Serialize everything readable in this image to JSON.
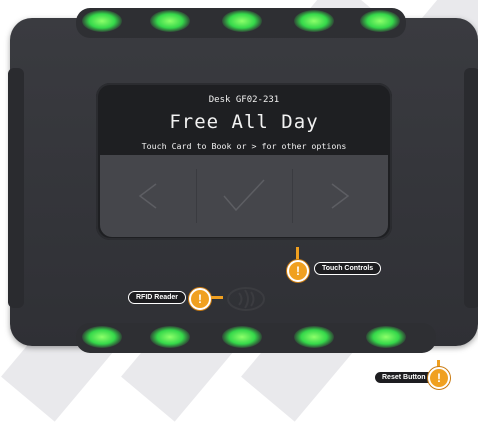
{
  "screen": {
    "desk_id": "Desk GF02-231",
    "status": "Free All Day",
    "instruction": "Touch Card to Book or > for other options"
  },
  "touch_controls": {
    "left": "previous-arrow",
    "center": "checkmark",
    "right": "next-arrow"
  },
  "callouts": {
    "touch_controls": "Touch Controls",
    "rfid_reader": "RFID Reader",
    "reset_button": "Reset Button",
    "alert_glyph": "!"
  },
  "colors": {
    "led": "#35d84a",
    "callout_accent": "#f0a020",
    "device_body": "#333438"
  }
}
